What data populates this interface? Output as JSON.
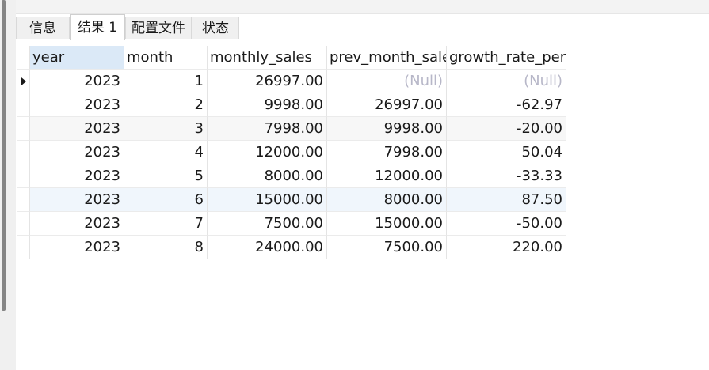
{
  "tabs": [
    {
      "label": "信息"
    },
    {
      "label": "结果 1"
    },
    {
      "label": "配置文件"
    },
    {
      "label": "状态"
    }
  ],
  "columns": [
    "year",
    "month",
    "monthly_sales",
    "prev_month_sales",
    "growth_rate_perc"
  ],
  "rows": [
    {
      "year": "2023",
      "month": "1",
      "monthly_sales": "26997.00",
      "prev_month_sales": "(Null)",
      "growth_rate": "(Null)"
    },
    {
      "year": "2023",
      "month": "2",
      "monthly_sales": "9998.00",
      "prev_month_sales": "26997.00",
      "growth_rate": "-62.97"
    },
    {
      "year": "2023",
      "month": "3",
      "monthly_sales": "7998.00",
      "prev_month_sales": "9998.00",
      "growth_rate": "-20.00"
    },
    {
      "year": "2023",
      "month": "4",
      "monthly_sales": "12000.00",
      "prev_month_sales": "7998.00",
      "growth_rate": "50.04"
    },
    {
      "year": "2023",
      "month": "5",
      "monthly_sales": "8000.00",
      "prev_month_sales": "12000.00",
      "growth_rate": "-33.33"
    },
    {
      "year": "2023",
      "month": "6",
      "monthly_sales": "15000.00",
      "prev_month_sales": "8000.00",
      "growth_rate": "87.50"
    },
    {
      "year": "2023",
      "month": "7",
      "monthly_sales": "7500.00",
      "prev_month_sales": "15000.00",
      "growth_rate": "-50.00"
    },
    {
      "year": "2023",
      "month": "8",
      "monthly_sales": "24000.00",
      "prev_month_sales": "7500.00",
      "growth_rate": "220.00"
    }
  ],
  "icons": {
    "current_row": "row-pointer-icon"
  },
  "colors": {
    "selected_header": "#dbe9f7",
    "null_text": "#b7b7c8",
    "highlight_row": "#f0f6fc"
  }
}
